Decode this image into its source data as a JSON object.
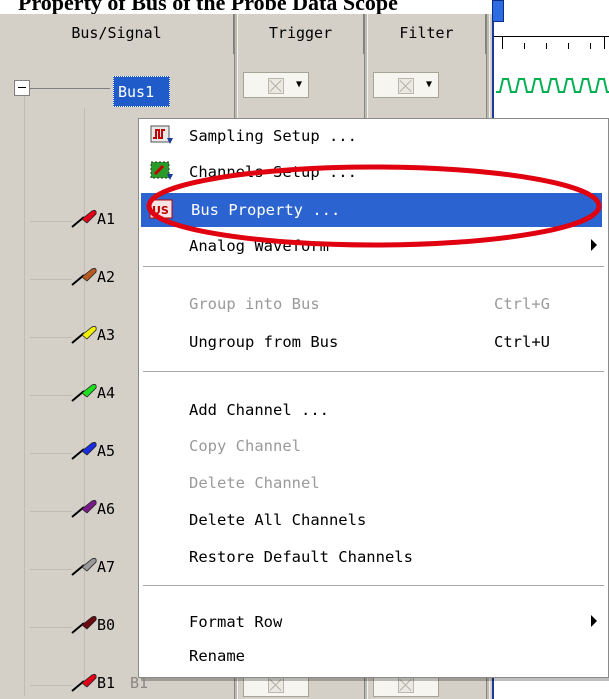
{
  "caption": {
    "text": "Property of Bus of the Probe Data Scope"
  },
  "header": {
    "bus_signal": "Bus/Signal",
    "trigger": "Trigger",
    "filter": "Filter"
  },
  "tree": {
    "bus": "Bus1",
    "rows": [
      {
        "label": "A1",
        "color": "#e0001a"
      },
      {
        "label": "A2",
        "color": "#b85a22"
      },
      {
        "label": "A3",
        "color": "#f2f200"
      },
      {
        "label": "A4",
        "color": "#1ee01e"
      },
      {
        "label": "A5",
        "color": "#1a2ee0"
      },
      {
        "label": "A6",
        "color": "#7a1a8a"
      },
      {
        "label": "A7",
        "color": "#9a9a9a"
      },
      {
        "label": "B0",
        "color": "#6a0a10"
      },
      {
        "label": "B1",
        "color": "#e0001a",
        "sub": "B1"
      }
    ]
  },
  "menu": {
    "items": [
      {
        "label": "Sampling Setup ...",
        "icon": "sampling-icon"
      },
      {
        "label": "Channels Setup ...",
        "icon": "channels-icon"
      },
      {
        "label": "Bus Property ...",
        "icon": "bus-property-icon",
        "selected": true
      },
      {
        "label": "Analog Waveform",
        "submenu": true
      },
      {
        "label": "Group into Bus",
        "shortcut": "Ctrl+G",
        "disabled": true
      },
      {
        "label": "Ungroup from Bus",
        "shortcut": "Ctrl+U"
      },
      {
        "label": "Add Channel ..."
      },
      {
        "label": "Copy Channel",
        "disabled": true
      },
      {
        "label": "Delete Channel",
        "disabled": true
      },
      {
        "label": "Delete All Channels"
      },
      {
        "label": "Restore Default Channels"
      },
      {
        "label": "Format Row",
        "submenu": true
      },
      {
        "label": "Rename"
      }
    ]
  },
  "colors": {
    "selection": "#2b63d0",
    "annotation": "#e00010"
  }
}
